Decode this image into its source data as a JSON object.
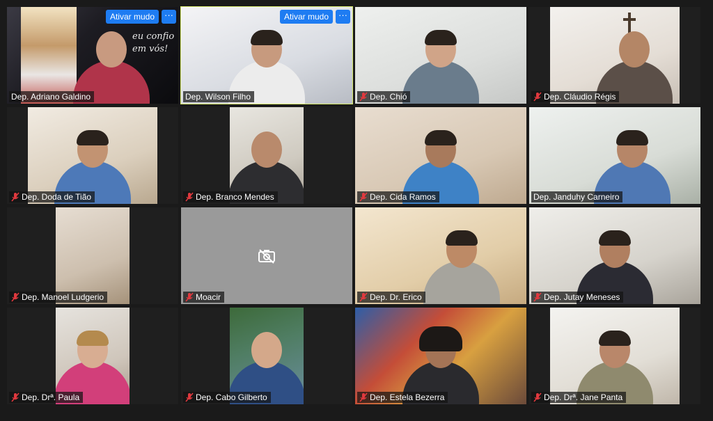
{
  "tiles": [
    {
      "name": "Dep. Adriano Galdino",
      "unmute": "Ativar mudo",
      "more": "···",
      "overlay_text": [
        "eu confio",
        "em vós!"
      ]
    },
    {
      "name": "Dep. Wilson Filho",
      "unmute": "Ativar mudo",
      "more": "···"
    },
    {
      "name": "Dep. Chió"
    },
    {
      "name": "Dep. Cláudio Régis"
    },
    {
      "name": "Dep. Doda de Tião"
    },
    {
      "name": "Dep. Branco Mendes"
    },
    {
      "name": "Dep. Cida Ramos"
    },
    {
      "name": "Dep. Janduhy Carneiro"
    },
    {
      "name": "Dep. Manoel Ludgerio"
    },
    {
      "name": "Moacir"
    },
    {
      "name": "Dep. Dr. Erico"
    },
    {
      "name": "Dep. Jutay Meneses"
    },
    {
      "name": "Dep. Drª. Paula"
    },
    {
      "name": "Dep. Cabo Gilberto"
    },
    {
      "name": "Dep. Estela Bezerra"
    },
    {
      "name": "Dep. Drª. Jane Panta"
    }
  ],
  "colors": {
    "accent_button": "#1e7cf2",
    "active_speaker_border": "#d5e86a",
    "muted_mic": "#e0393e",
    "background": "#1a1a1a"
  }
}
